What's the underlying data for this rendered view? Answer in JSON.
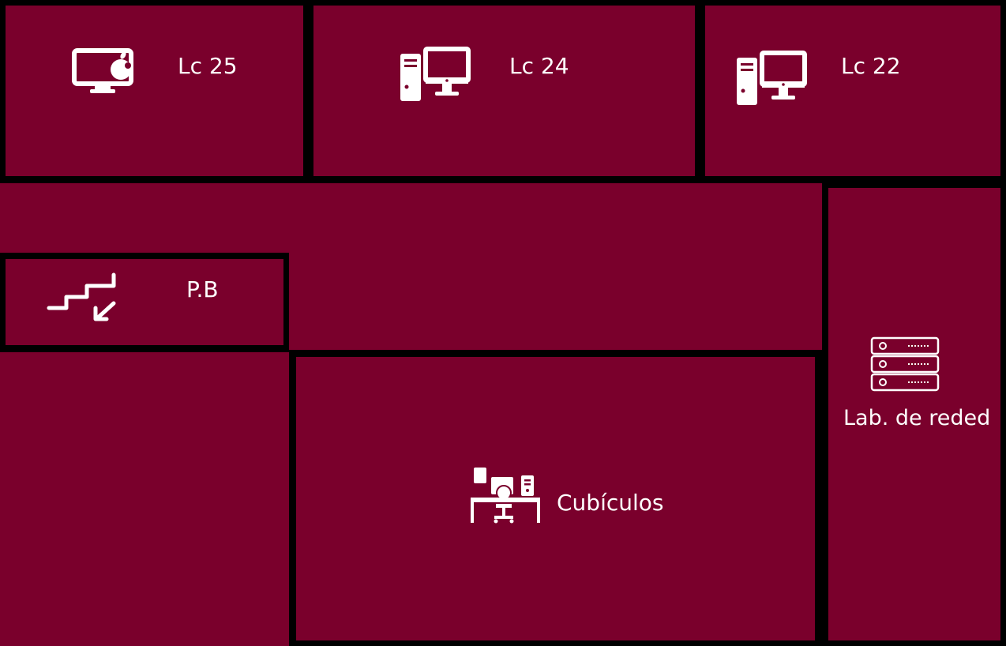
{
  "colors": {
    "room": "#7a002c",
    "wall": "#000000",
    "label": "#ffffff"
  },
  "rooms": {
    "lc25": {
      "label": "Lc 25",
      "icon": "imac-apple-icon"
    },
    "lc24": {
      "label": "Lc 24",
      "icon": "desktop-tower-icon"
    },
    "lc22": {
      "label": "Lc 22",
      "icon": "desktop-tower-icon"
    },
    "pb": {
      "label": "P.B",
      "icon": "stairs-down-icon"
    },
    "lab_redes": {
      "label": "Lab. de reded",
      "icon": "server-rack-icon"
    },
    "cubiculos": {
      "label": "Cubículos",
      "icon": "office-desk-icon"
    }
  }
}
